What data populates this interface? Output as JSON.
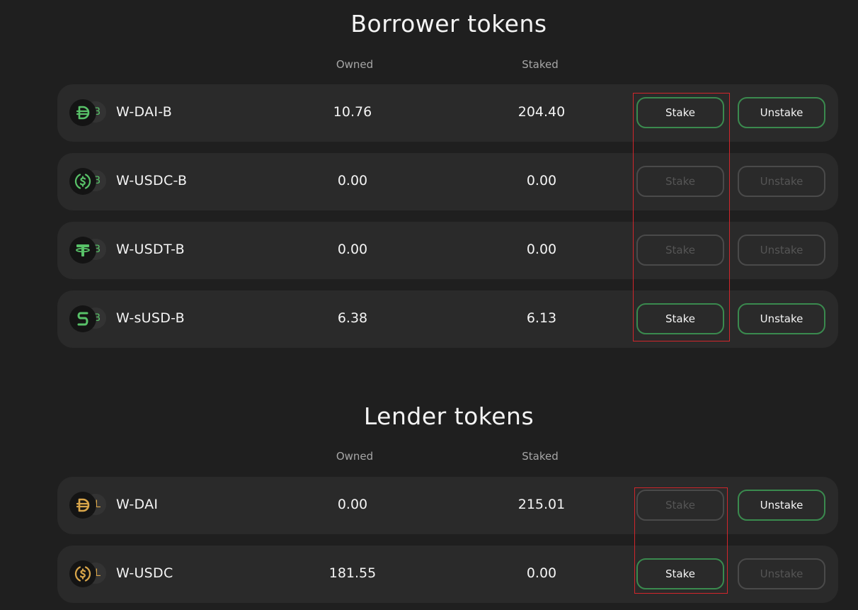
{
  "borrower": {
    "title": "Borrower tokens",
    "col_owned": "Owned",
    "col_staked": "Staked",
    "rows": [
      {
        "name": "W-DAI-B",
        "owned": "10.76",
        "staked": "204.40",
        "icon": "dai-icon",
        "badge": "B",
        "stake_label": "Stake",
        "unstake_label": "Unstake",
        "stake_enabled": true,
        "unstake_enabled": true
      },
      {
        "name": "W-USDC-B",
        "owned": "0.00",
        "staked": "0.00",
        "icon": "usdc-icon",
        "badge": "B",
        "stake_label": "Stake",
        "unstake_label": "Unstake",
        "stake_enabled": false,
        "unstake_enabled": false
      },
      {
        "name": "W-USDT-B",
        "owned": "0.00",
        "staked": "0.00",
        "icon": "usdt-icon",
        "badge": "B",
        "stake_label": "Stake",
        "unstake_label": "Unstake",
        "stake_enabled": false,
        "unstake_enabled": false
      },
      {
        "name": "W-sUSD-B",
        "owned": "6.38",
        "staked": "6.13",
        "icon": "susd-icon",
        "badge": "B",
        "stake_label": "Stake",
        "unstake_label": "Unstake",
        "stake_enabled": true,
        "unstake_enabled": true
      }
    ]
  },
  "lender": {
    "title": "Lender tokens",
    "col_owned": "Owned",
    "col_staked": "Staked",
    "rows": [
      {
        "name": "W-DAI",
        "owned": "0.00",
        "staked": "215.01",
        "icon": "dai-icon",
        "badge": "L",
        "stake_label": "Stake",
        "unstake_label": "Unstake",
        "stake_enabled": false,
        "unstake_enabled": true
      },
      {
        "name": "W-USDC",
        "owned": "181.55",
        "staked": "0.00",
        "icon": "usdc-icon",
        "badge": "L",
        "stake_label": "Stake",
        "unstake_label": "Unstake",
        "stake_enabled": true,
        "unstake_enabled": false
      }
    ]
  },
  "colors": {
    "background": "#1f1f1f",
    "row": "#2a2a2a",
    "accent_green": "#58c168",
    "accent_gold": "#d9a64a",
    "button_border_active": "#3a8a4e",
    "highlight_box": "#d1262b"
  }
}
